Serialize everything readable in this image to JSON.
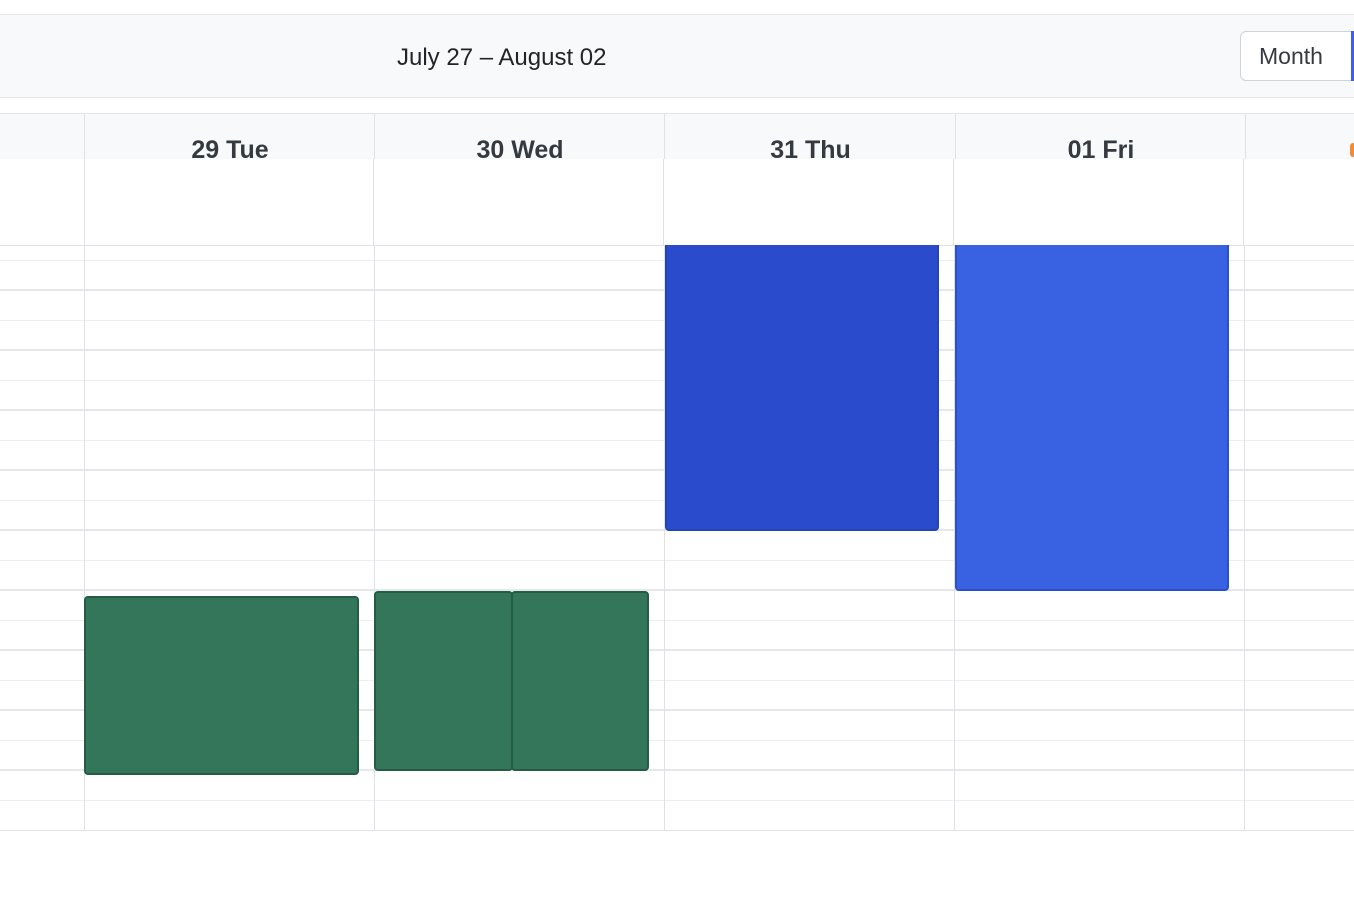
{
  "toolbar": {
    "range_title": "July 27 – August 02",
    "view_button_label": "Month"
  },
  "days": [
    {
      "label": "29 Tue"
    },
    {
      "label": "30 Wed"
    },
    {
      "label": "31 Thu"
    },
    {
      "label": "01 Fri"
    }
  ],
  "colors": {
    "green_event": "#33765a",
    "green_border": "#245c45",
    "blue_dark_event": "#2a4ccc",
    "blue_light_event": "#3962e3",
    "blue_border": "#2244b5",
    "today_marker": "#f08c3a"
  }
}
